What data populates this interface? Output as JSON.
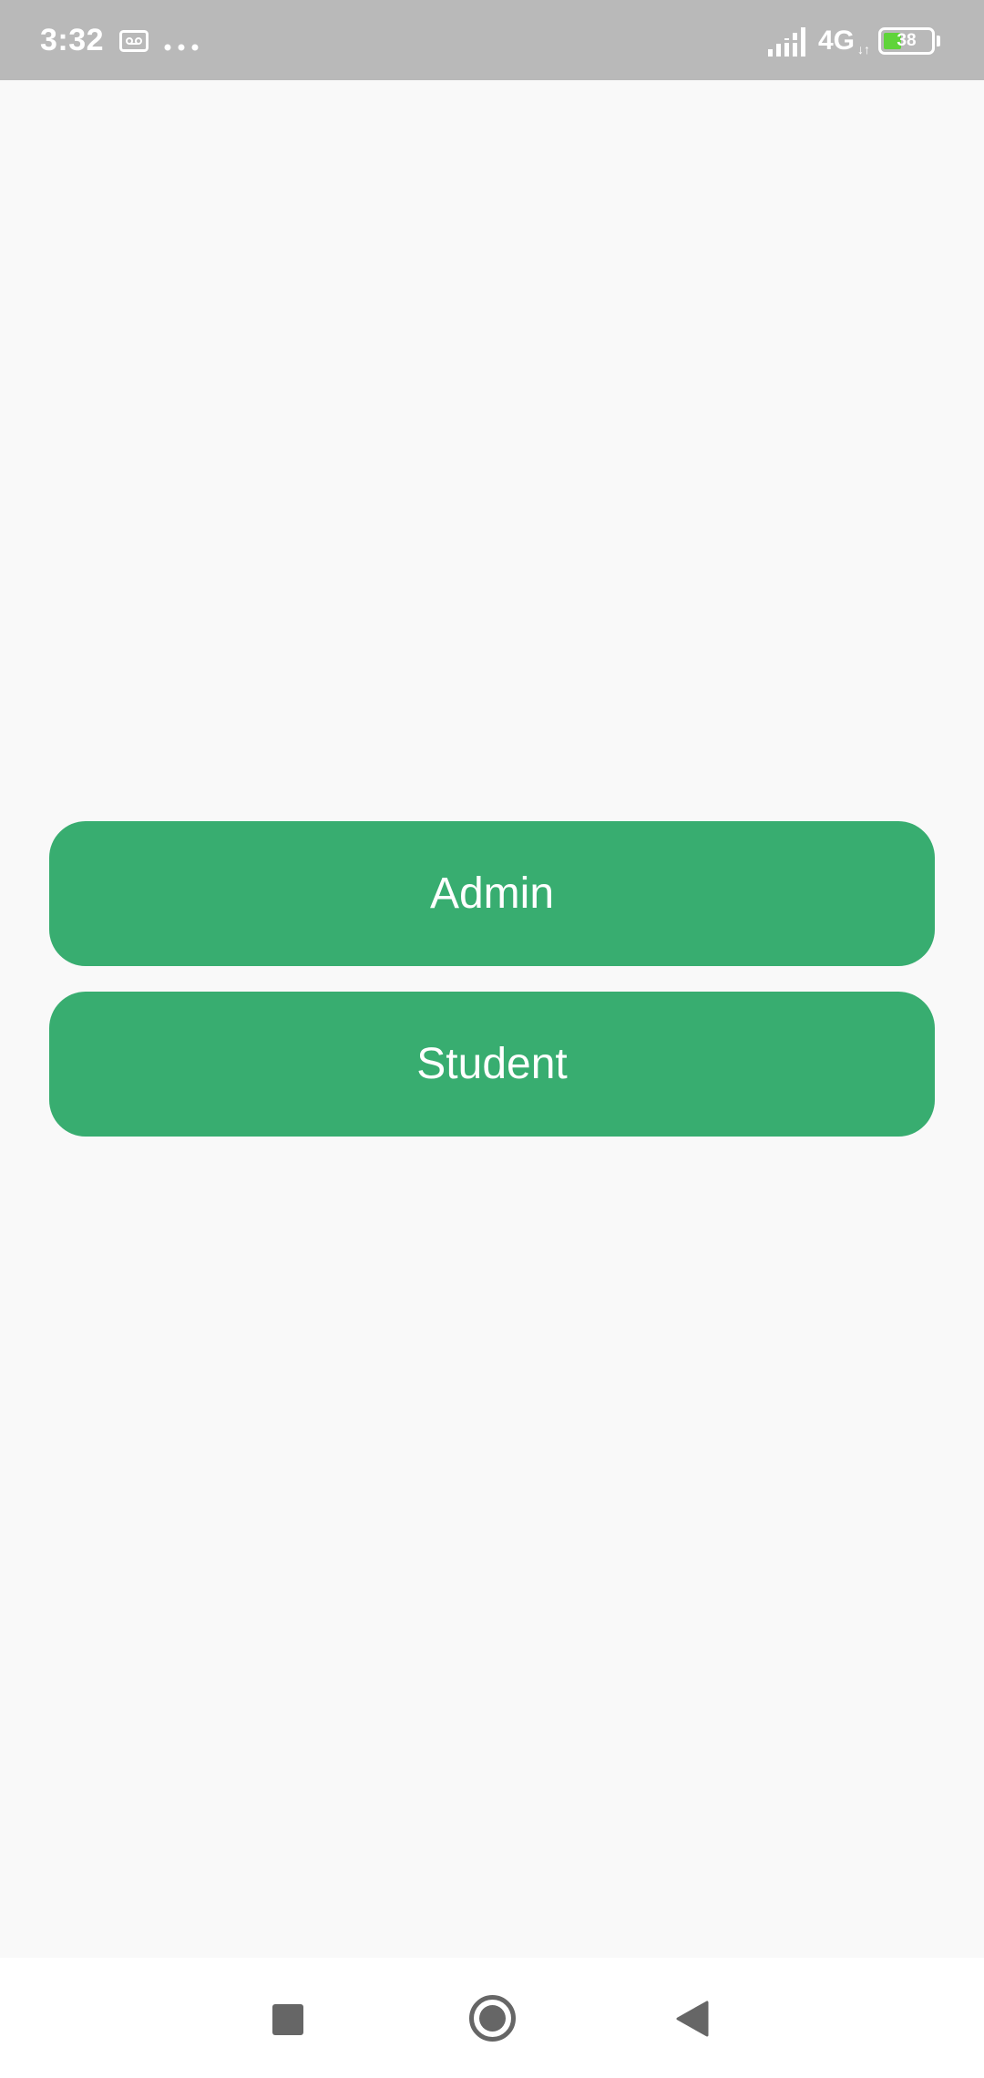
{
  "status_bar": {
    "time": "3:32",
    "network": "4G",
    "network_arrows": "↓↑",
    "battery_level": "38",
    "battery_percent": 38,
    "icons": [
      "voicemail-icon",
      "more-dots-icon",
      "signal-icon",
      "battery-icon"
    ],
    "battery_color": "#5fd43a"
  },
  "main": {
    "buttons": [
      {
        "label": "Admin"
      },
      {
        "label": "Student"
      }
    ],
    "button_color": "#38ad70"
  },
  "nav_bar": {
    "icons": [
      "recents-icon",
      "home-icon",
      "back-icon"
    ]
  }
}
